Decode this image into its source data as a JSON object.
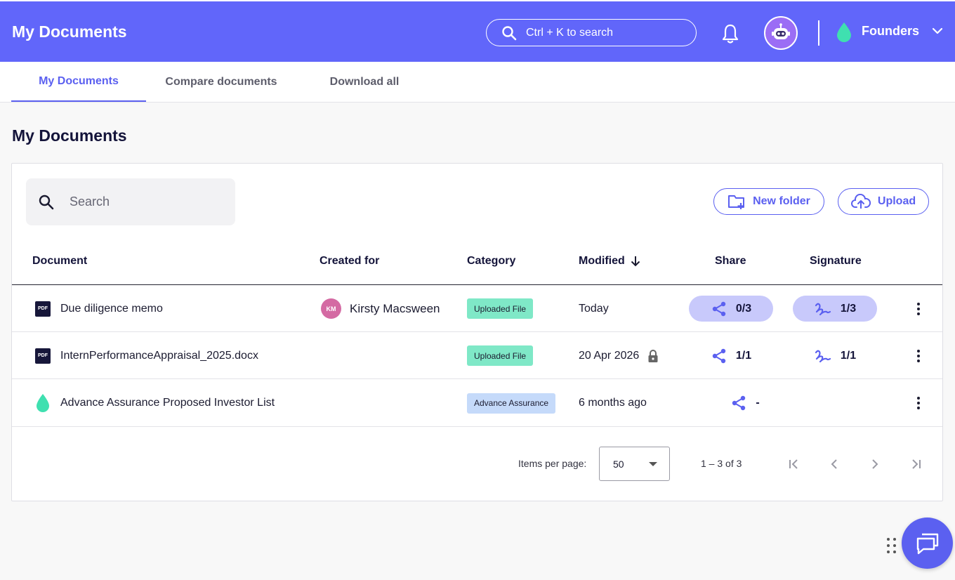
{
  "header": {
    "title": "My Documents",
    "search_placeholder": "Ctrl + K to search",
    "org_name": "Founders",
    "brand_color": "#6166fa"
  },
  "tabs": [
    {
      "label": "My Documents",
      "active": true
    },
    {
      "label": "Compare documents",
      "active": false
    },
    {
      "label": "Download all",
      "active": false
    }
  ],
  "main": {
    "title": "My Documents",
    "search_placeholder": "Search",
    "new_folder_label": "New folder",
    "upload_label": "Upload"
  },
  "table": {
    "columns": [
      "Document",
      "Created for",
      "Category",
      "Modified",
      "Share",
      "Signature"
    ],
    "sort_column": "Modified",
    "sort_direction": "descending",
    "rows": [
      {
        "document": "Due diligence memo",
        "doc_icon": "pdf-icon",
        "created_for_initials": "KM",
        "created_for": "Kirsty Macsween",
        "category": "Uploaded File",
        "category_color": "#7fe8c7",
        "modified": "Today",
        "locked": false,
        "share": "0/3",
        "signature": "1/3"
      },
      {
        "document": "InternPerformanceAppraisal_2025.docx",
        "doc_icon": "pdf-icon",
        "created_for_initials": "",
        "created_for": "",
        "category": "Uploaded File",
        "category_color": "#7fe8c7",
        "modified": "20 Apr 2026",
        "locked": true,
        "share": "1/1",
        "signature": "1/1"
      },
      {
        "document": "Advance Assurance Proposed Investor List",
        "doc_icon": "droplet-icon",
        "created_for_initials": "",
        "created_for": "",
        "category": "Advance Assurance",
        "category_color": "#c5dafa",
        "modified": "6 months ago",
        "locked": false,
        "share": "-",
        "signature": ""
      }
    ]
  },
  "pager": {
    "items_per_page_label": "Items per page:",
    "items_per_page": "50",
    "range": "1 – 3 of 3"
  }
}
